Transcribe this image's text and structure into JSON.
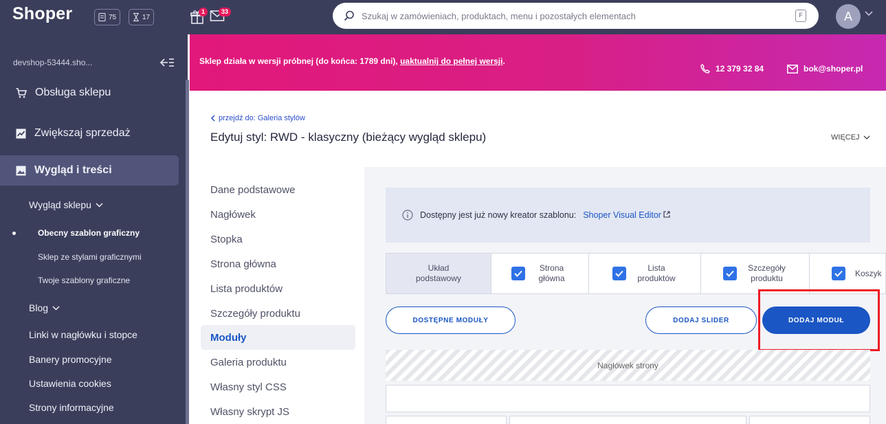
{
  "topbar": {
    "brand": "Shoper",
    "counter_orders": "75",
    "counter_pending": "17",
    "gift_badge": "1",
    "mail_badge": "33",
    "search_placeholder": "Szukaj w zamówieniach, produktach, menu i pozostałych elementach",
    "filter_icon_label": "F",
    "avatar_letter": "A"
  },
  "sidebar": {
    "shop_name": "devshop-53444.sho...",
    "main_items": [
      "Obsługa sklepu",
      "Zwiększaj sprzedaż",
      "Wygląd i treści"
    ],
    "appearance_group": "Wygląd sklepu",
    "appearance_items": [
      "Obecny szablon graficzny",
      "Sklep ze stylami graficznymi",
      "Twoje szablony graficzne"
    ],
    "blog_group": "Blog",
    "other_items": [
      "Linki w nagłówku i stopce",
      "Banery promocyjne",
      "Ustawienia cookies",
      "Strony informacyjne"
    ]
  },
  "banner": {
    "text": "Sklep działa w wersji próbnej (do końca: 1789 dni),",
    "link": "uaktualnij do pełnej wersji",
    "end": ".",
    "phone": "12 379 32 84",
    "email": "bok@shoper.pl"
  },
  "header": {
    "back_link": "przejdź do: Galeria stylów",
    "title": "Edytuj styl: RWD - klasyczny (bieżący wygląd sklepu)",
    "more": "WIĘCEJ"
  },
  "submenu": [
    "Dane podstawowe",
    "Nagłówek",
    "Stopka",
    "Strona główna",
    "Lista produktów",
    "Szczegóły produktu",
    "Moduły",
    "Galeria produktu",
    "Własny styl CSS",
    "Własny skrypt JS"
  ],
  "notice": {
    "text": "Dostępny jest już nowy kreator szablonu:",
    "link": "Shoper Visual Editor"
  },
  "tabs": [
    {
      "label": "Układ podstawowy",
      "checked": false
    },
    {
      "label": "Strona główna",
      "checked": true
    },
    {
      "label": "Lista produktów",
      "checked": true
    },
    {
      "label": "Szczegóły produktu",
      "checked": true
    },
    {
      "label": "Koszyk",
      "checked": true
    }
  ],
  "buttons": {
    "available_modules": "DOSTĘPNE MODUŁY",
    "add_slider": "DODAJ SLIDER",
    "add_module": "DODAJ MODUŁ"
  },
  "layout": {
    "header_zone": "Nagłówek strony"
  },
  "colors": {
    "sidebar": "#3b3e5b",
    "accent": "#1a56c4",
    "banner_start": "#e2187a",
    "banner_end": "#c629b0",
    "highlight": "#ee1c25"
  }
}
